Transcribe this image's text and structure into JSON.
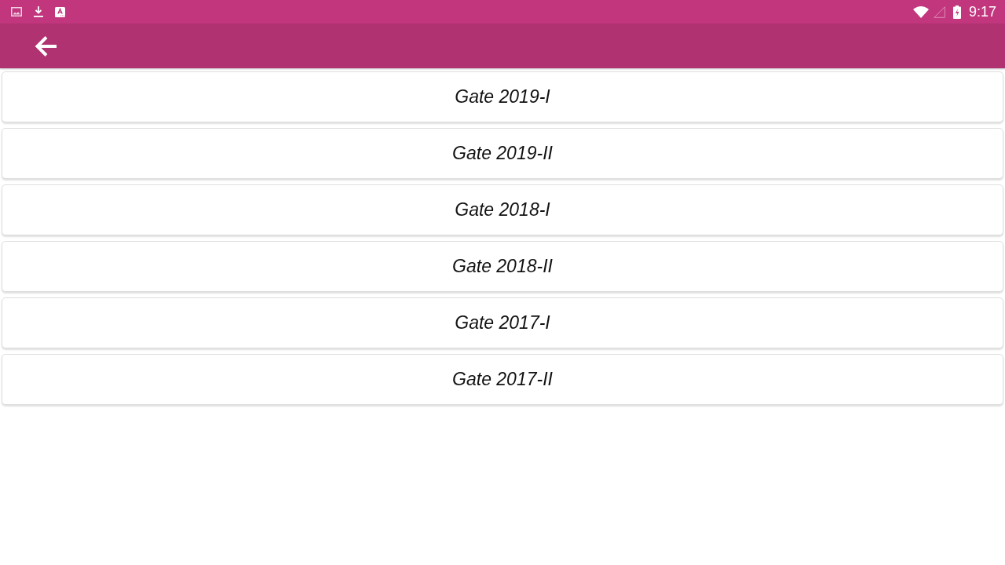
{
  "status_bar": {
    "time": "9:17"
  },
  "items": [
    {
      "label": "Gate 2019-I"
    },
    {
      "label": "Gate 2019-II"
    },
    {
      "label": "Gate 2018-I"
    },
    {
      "label": "Gate 2018-II"
    },
    {
      "label": "Gate 2017-I"
    },
    {
      "label": "Gate 2017-II"
    }
  ]
}
